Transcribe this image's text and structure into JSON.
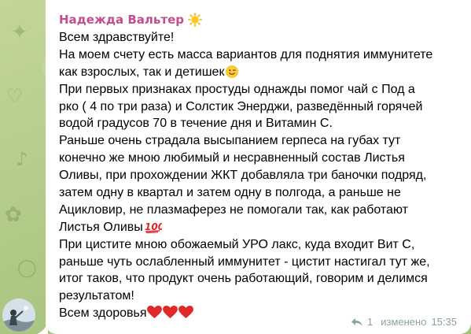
{
  "message": {
    "sender": "Надежда Вальтер",
    "sender_emoji_icon": "sun-icon",
    "lines": [
      "Всем здравствуйте!",
      "На моем счету есть масса вариантов для поднятия иммунитете",
      "как взрослых, так и детишек",
      "При первых признаках простуды однажды помог чай с Под а",
      "рко ( 4 по три раза) и Солстик Энерджи, разведённый горячей",
      "водой градусов 70 в течение дня и Витамин С.",
      "Раньше очень страдала высыпанием герпеса на губах тут",
      "конечно же мною любимый и несравненный состав Листья",
      "Оливы, при прохождении ЖКТ добавляла три баночки подряд,",
      "затем одну в квартал и затем одну в полгода, а раньше не",
      "Ацикловир, не плазмаферез не помогали так, как работают",
      "Листья Оливы",
      "При цистите мною обожаемый УРО лакс, куда входит Вит С,",
      "раньше чуть ослабленный иммунитет - цистит настигал тут же,",
      "итог таков, что продукт очень работающий, говорим и делимся",
      "результатом!",
      "Всем здоровья"
    ],
    "inline_icons": {
      "line_3": "wink-emoji-icon",
      "line_12": "hundred-points-emoji-icon",
      "line_17": [
        "red-heart-emoji-icon",
        "red-heart-emoji-icon",
        "red-heart-emoji-icon"
      ]
    },
    "replies_count": "1",
    "edited_label": "изменено",
    "time": "15:35"
  },
  "colors": {
    "sender": "#c14f8c",
    "meta": "#8aa39a",
    "bubble": "#ffffff",
    "wallpaper": "#b7cf8f",
    "heart": "#e02a2a"
  }
}
